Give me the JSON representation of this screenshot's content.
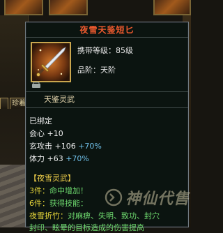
{
  "background": {
    "tabs": [
      "",
      "珍着"
    ]
  },
  "tooltip": {
    "title": "夜雪天鉴短匕",
    "item_icon": "dagger-icon",
    "carry_level_label": "携带等级：",
    "carry_level_value": "85级",
    "grade_label": "品阶：",
    "grade_value": "天阶",
    "subtitle": "天鉴灵武",
    "bound_status": "已绑定",
    "attributes": [
      {
        "name": "会心",
        "value": "+10",
        "bonus": ""
      },
      {
        "name": "玄攻击",
        "value": "+106",
        "bonus": "+70%"
      },
      {
        "name": "体力",
        "value": "+63",
        "bonus": "+70%"
      }
    ],
    "set": {
      "title": "【夜雪灵武】",
      "lines": [
        {
          "label": "3件：",
          "text": "命中增加！"
        },
        {
          "label": "6件：",
          "text": "获得技能："
        },
        {
          "label": "夜雪折竹：",
          "text": "对麻痹、失明、致功、封穴"
        },
        {
          "label": "",
          "text": "封印、眩晕的目标造成的伤害提高"
        }
      ]
    },
    "colors": {
      "title": "#ee5a2e",
      "bonus": "#6fbfe8",
      "set_title": "#f1d04a",
      "set_text": "#6ed96e"
    }
  },
  "watermark": {
    "text": "神仙代售"
  }
}
